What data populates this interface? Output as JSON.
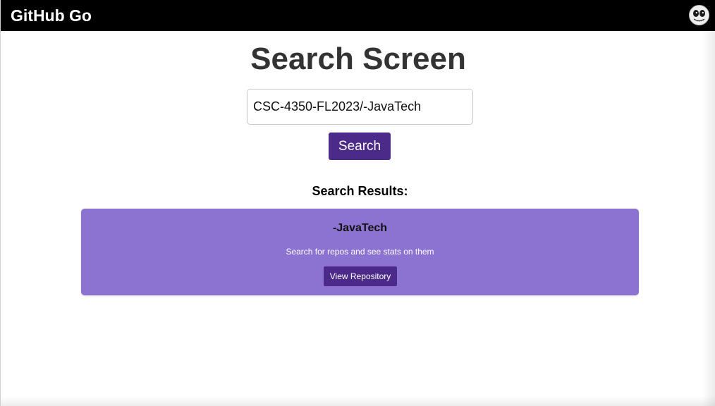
{
  "navbar": {
    "brand": "GitHub Go",
    "avatar_icon": "user-avatar-icon"
  },
  "main": {
    "title": "Search Screen",
    "search": {
      "value": "CSC-4350-FL2023/-JavaTech",
      "placeholder": ""
    },
    "search_button_label": "Search",
    "results_heading": "Search Results:",
    "results": [
      {
        "name": "-JavaTech",
        "description": "Search for repos and see stats on them",
        "view_button_label": "View Repository"
      }
    ]
  },
  "colors": {
    "navbar": "#000000",
    "accent": "#4b2a8a",
    "card": "#8c73d1",
    "title": "#333333"
  }
}
